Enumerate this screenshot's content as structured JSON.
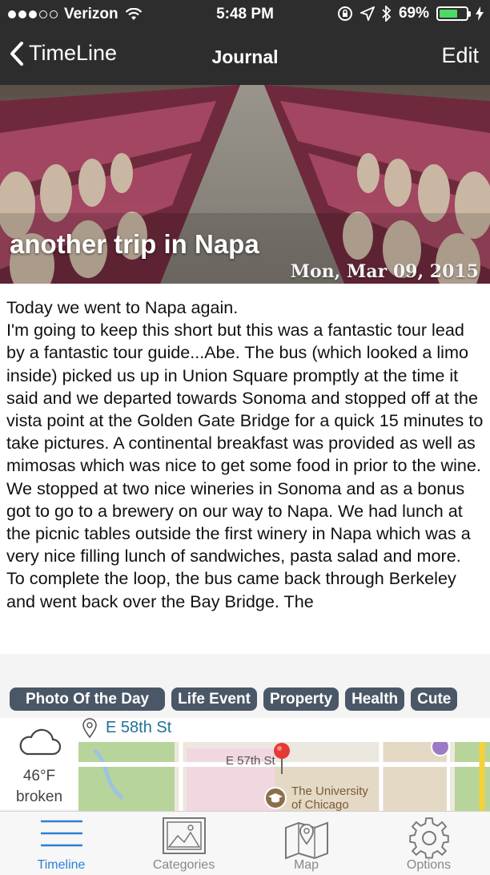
{
  "status": {
    "carrier": "Verizon",
    "time": "5:48 PM",
    "battery": "69%",
    "battery_level": 0.69
  },
  "nav": {
    "back_label": "TimeLine",
    "title": "Journal",
    "edit_label": "Edit"
  },
  "entry": {
    "title": "another trip in Napa",
    "date": "Mon, Mar 09, 2015",
    "paragraphs": [
      "Today we went to Napa again.",
      "I'm going to keep this short but this was a fantastic tour lead by a fantastic tour guide...Abe. The bus (which looked a limo inside) picked us up in Union Square promptly at the time it said and we departed towards Sonoma and stopped off at the vista point at the Golden Gate Bridge for a quick 15 minutes to take pictures. A continental breakfast was provided as well as mimosas which was nice to get some food in prior to the wine. We stopped at two nice wineries in Sonoma and as a bonus got to go to a brewery on our way to Napa. We had lunch at the picnic tables outside the first winery in Napa which was a very nice filling lunch of sandwiches, pasta salad and more. To complete the loop, the bus came back through Berkeley and went back over the Bay Bridge. The"
    ]
  },
  "tags": [
    "Photo Of the Day",
    "Life Event",
    "Property",
    "Health",
    "Cute"
  ],
  "weather": {
    "temp": "46°F",
    "condition": "broken",
    "icon": "cloud-icon"
  },
  "location": {
    "label": "E 58th St"
  },
  "map": {
    "street_label": "E 57th St",
    "poi_line1": "The University",
    "poi_line2": "of Chicago"
  },
  "tabbar": [
    {
      "label": "Timeline",
      "icon": "list-icon",
      "active": true
    },
    {
      "label": "Categories",
      "icon": "image-icon",
      "active": false
    },
    {
      "label": "Map",
      "icon": "map-icon",
      "active": false
    },
    {
      "label": "Options",
      "icon": "gear-icon",
      "active": false
    }
  ],
  "colors": {
    "accent": "#2b7fd6",
    "tag_bg": "#4a5766",
    "location_text": "#23709a",
    "battery_fill": "#4cd964"
  }
}
